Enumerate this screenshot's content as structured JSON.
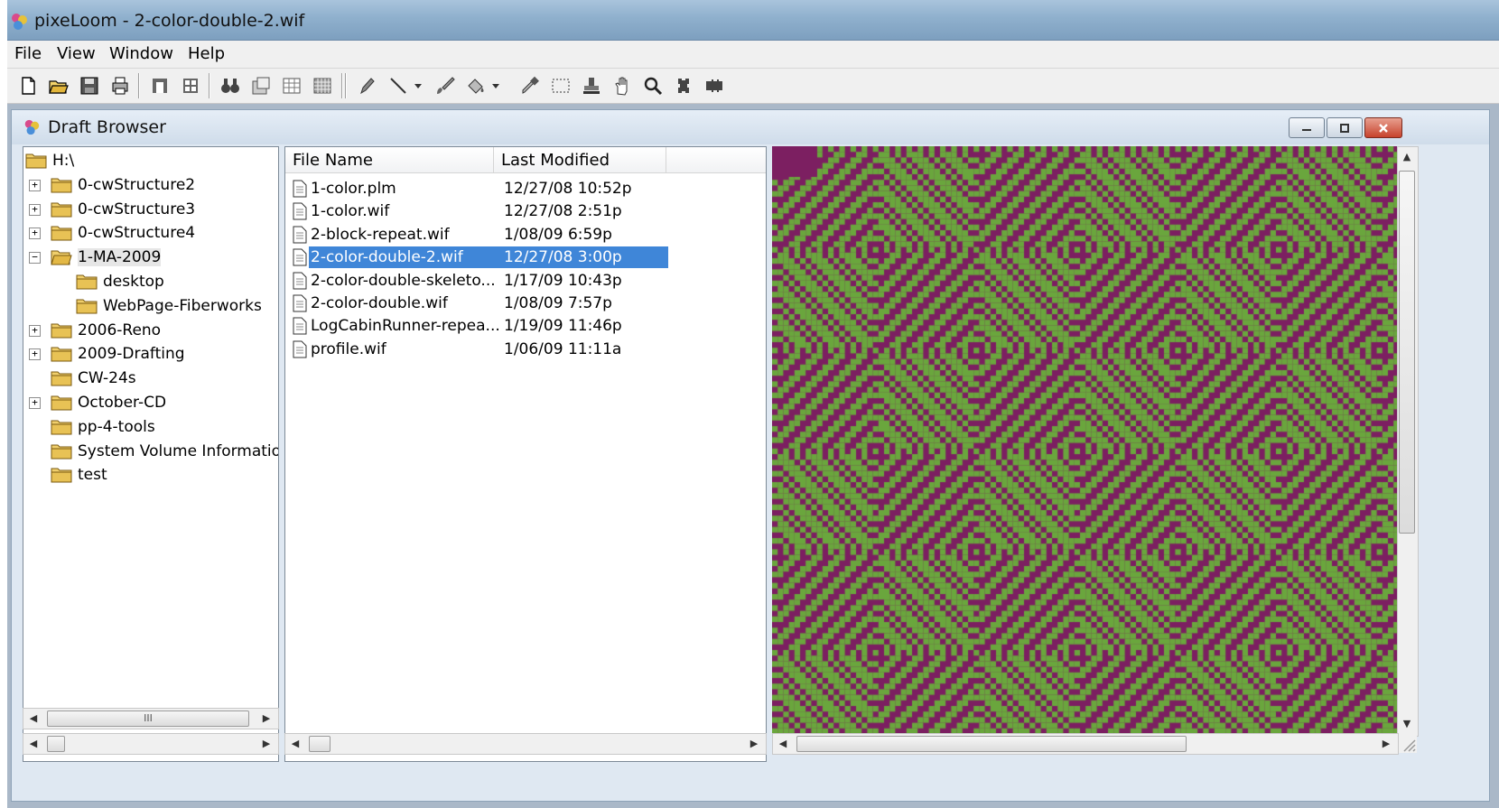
{
  "window": {
    "title": "pixeLoom - 2-color-double-2.wif"
  },
  "menu": {
    "items": [
      "File",
      "View",
      "Window",
      "Help"
    ]
  },
  "toolbar": {
    "icons": [
      "new-file-icon",
      "open-folder-icon",
      "save-icon",
      "print-icon",
      "layout-a-icon",
      "layout-b-icon",
      "binoculars-icon",
      "properties-icon",
      "grid-icon",
      "grid-fill-icon",
      "pencil-icon",
      "line-icon",
      "dropdown-arrow-icon",
      "brush-icon",
      "fill-icon",
      "dropdown-arrow-icon",
      "eyedropper-icon",
      "select-rect-icon",
      "stamp-icon",
      "hand-icon",
      "zoom-icon",
      "puzzle-a-icon",
      "puzzle-b-icon"
    ]
  },
  "browser": {
    "title": "Draft Browser",
    "tree": [
      {
        "label": "H:\\",
        "level": 0,
        "expander": "",
        "open": false
      },
      {
        "label": "0-cwStructure2",
        "level": 1,
        "expander": "+",
        "open": false
      },
      {
        "label": "0-cwStructure3",
        "level": 1,
        "expander": "+",
        "open": false
      },
      {
        "label": "0-cwStructure4",
        "level": 1,
        "expander": "+",
        "open": false
      },
      {
        "label": "1-MA-2009",
        "level": 1,
        "expander": "−",
        "open": true,
        "selected": true
      },
      {
        "label": "desktop",
        "level": 2,
        "expander": "",
        "open": false
      },
      {
        "label": "WebPage-Fiberworks",
        "level": 2,
        "expander": "",
        "open": false
      },
      {
        "label": "2006-Reno",
        "level": 1,
        "expander": "+",
        "open": false
      },
      {
        "label": "2009-Drafting",
        "level": 1,
        "expander": "+",
        "open": false
      },
      {
        "label": "CW-24s",
        "level": 1,
        "expander": "",
        "open": false
      },
      {
        "label": "October-CD",
        "level": 1,
        "expander": "+",
        "open": false
      },
      {
        "label": "pp-4-tools",
        "level": 1,
        "expander": "",
        "open": false
      },
      {
        "label": "System Volume Information",
        "level": 1,
        "expander": "",
        "open": false
      },
      {
        "label": "test",
        "level": 1,
        "expander": "",
        "open": false
      }
    ],
    "columns": [
      "File Name",
      "Last Modified"
    ],
    "files": [
      {
        "name": "1-color.plm",
        "modified": "12/27/08 10:52p"
      },
      {
        "name": "1-color.wif",
        "modified": "12/27/08 2:51p"
      },
      {
        "name": "2-block-repeat.wif",
        "modified": "1/08/09 6:59p"
      },
      {
        "name": "2-color-double-2.wif",
        "modified": "12/27/08 3:00p",
        "selected": true
      },
      {
        "name": "2-color-double-skeleto...",
        "modified": "1/17/09 10:43p"
      },
      {
        "name": "2-color-double.wif",
        "modified": "1/08/09 7:57p"
      },
      {
        "name": "LogCabinRunner-repea...",
        "modified": "1/19/09 11:46p"
      },
      {
        "name": "profile.wif",
        "modified": "1/06/09 11:11a"
      }
    ],
    "preview": {
      "color_a": "#7c1f61",
      "color_b": "#6aa63d"
    },
    "scroll_grip": "III"
  }
}
